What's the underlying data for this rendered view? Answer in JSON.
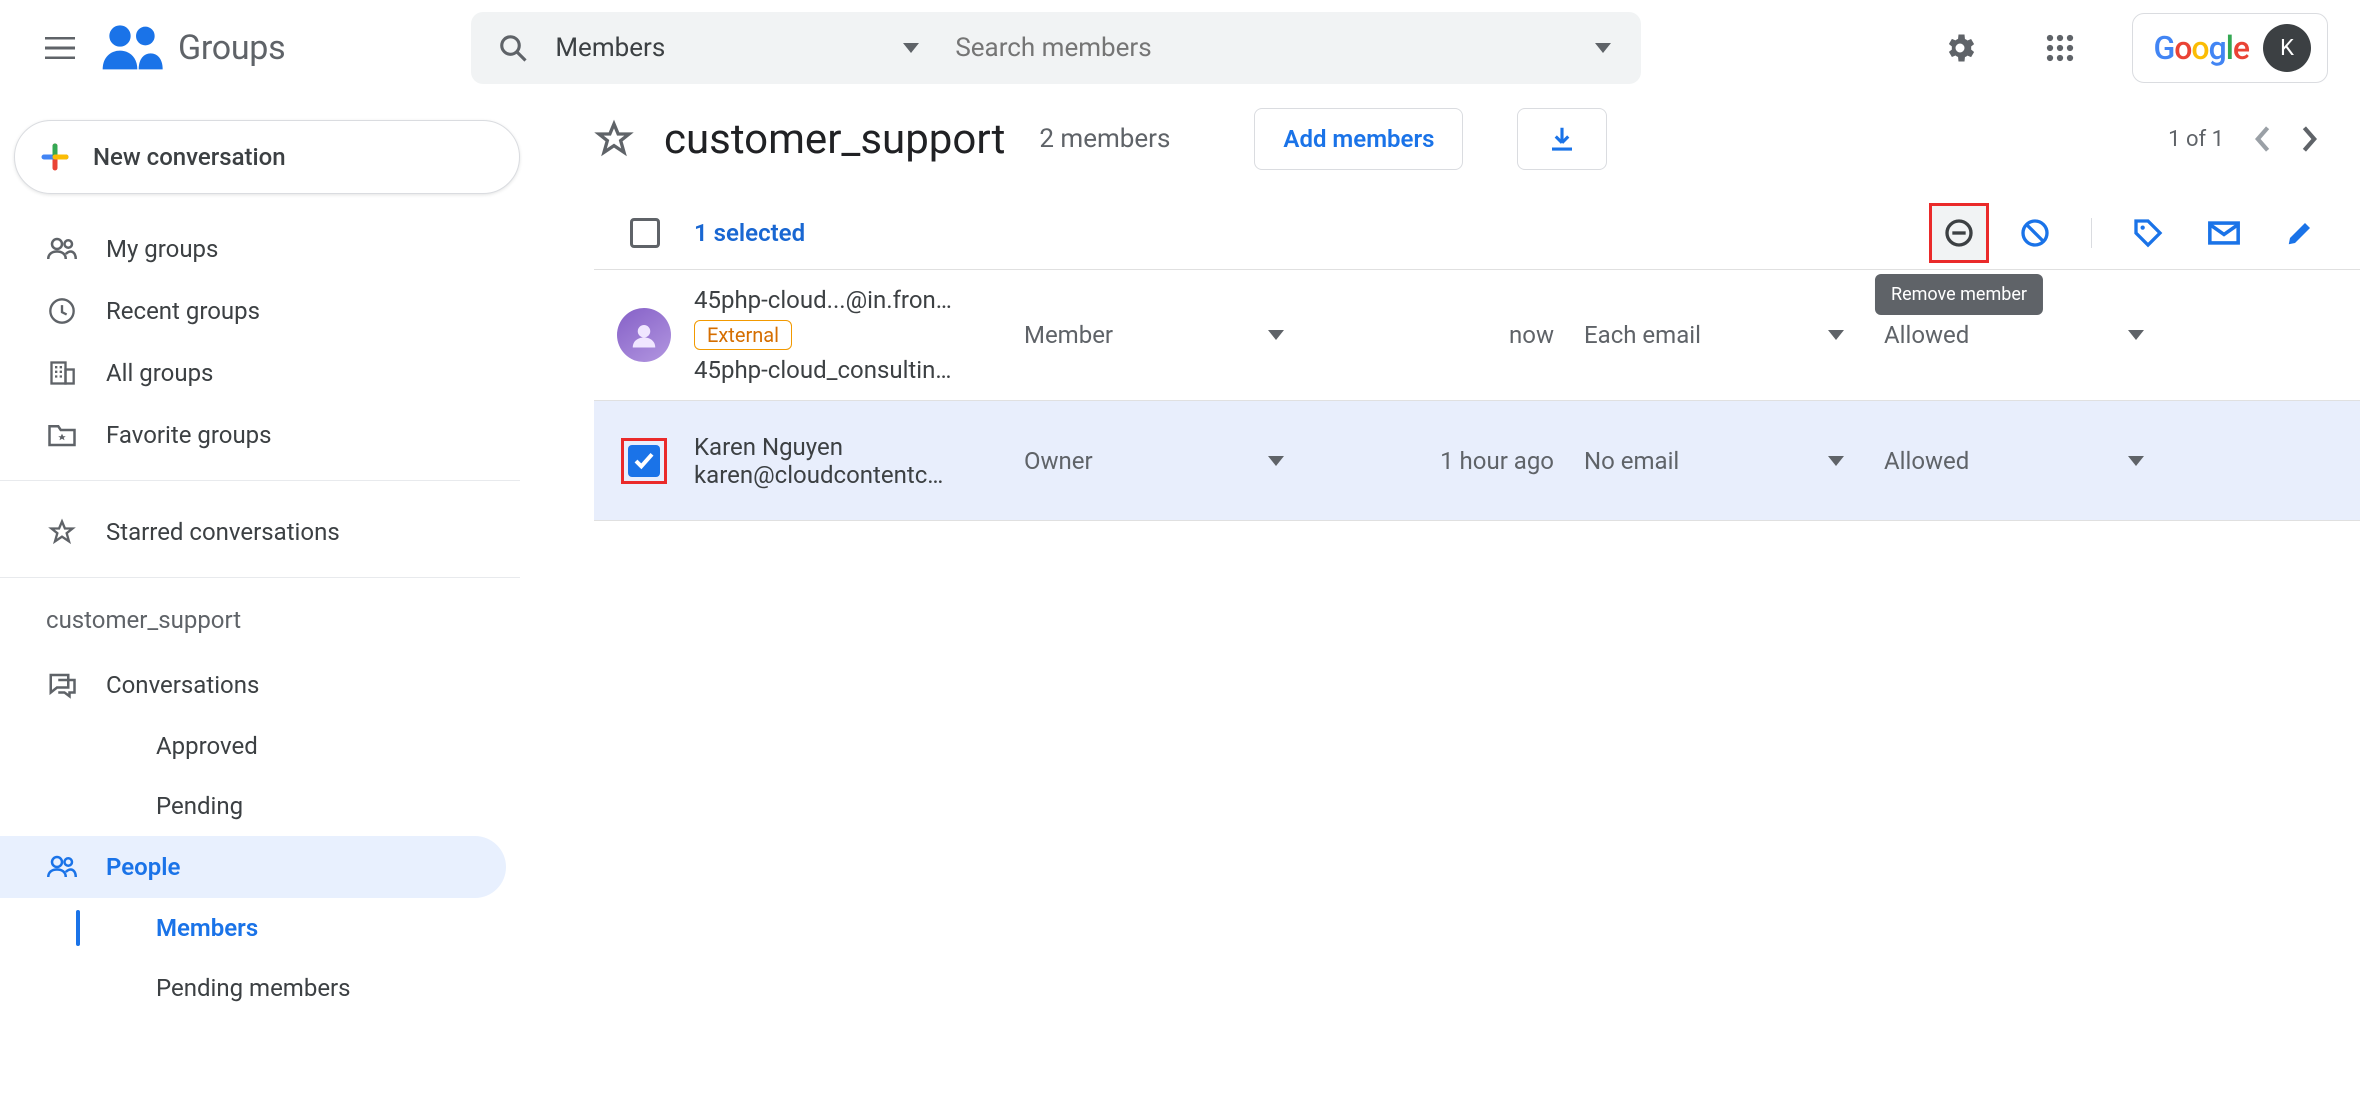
{
  "brand": {
    "product": "Groups",
    "account_initial": "K",
    "google": "Google"
  },
  "search": {
    "filter_label": "Members",
    "placeholder": "Search members"
  },
  "compose": {
    "label": "New conversation"
  },
  "nav": {
    "my_groups": "My groups",
    "recent": "Recent groups",
    "all": "All groups",
    "favorite": "Favorite groups",
    "starred": "Starred conversations"
  },
  "group": {
    "name": "customer_support",
    "conversations": "Conversations",
    "approved": "Approved",
    "pending": "Pending",
    "people": "People",
    "members": "Members",
    "pending_members": "Pending members"
  },
  "page": {
    "title": "customer_support",
    "count": "2 members",
    "add": "Add members",
    "pager": "1 of 1"
  },
  "selection": {
    "label": "1 selected",
    "tooltip_remove": "Remove member"
  },
  "rows": [
    {
      "name_top": "45php-cloud...@in.fron…",
      "external": "External",
      "name_bottom": "45php-cloud_consultin…",
      "role": "Member",
      "joined": "now",
      "subscription": "Each email",
      "posting": "Allowed",
      "selected": false
    },
    {
      "name_top": "Karen Nguyen",
      "name_bottom": "karen@cloudcontentc…",
      "role": "Owner",
      "joined": "1 hour ago",
      "subscription": "No email",
      "posting": "Allowed",
      "selected": true
    }
  ]
}
